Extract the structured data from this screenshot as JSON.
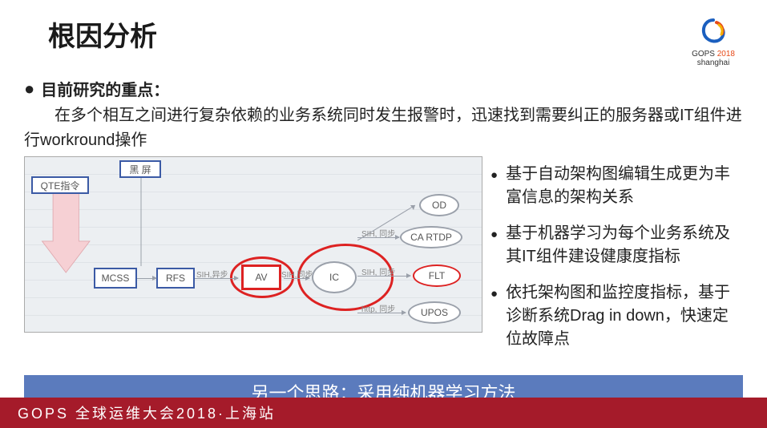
{
  "header": {
    "title": "根因分析",
    "logo_brand": "GOPS",
    "logo_year": "2018",
    "logo_city": "shanghai"
  },
  "focus": {
    "label": "目前研究的重点：",
    "body": "在多个相互之间进行复杂依赖的业务系统同时发生报警时，迅速找到需要纠正的服务器或IT组件进行workround操作"
  },
  "diagram": {
    "qte": "QTE指令",
    "blackscreen": "黑 屏",
    "mcss": "MCSS",
    "rfs": "RFS",
    "av": "AV",
    "ic": "IC",
    "od": "OD",
    "cartdp": "CA RTDP",
    "flt": "FLT",
    "upos": "UPOS",
    "labels": {
      "sih_sync1": "SIH,异步",
      "sih_sync2": "SIH,同步",
      "sih_sync3": "SIH, 同步",
      "sih_sync4": "SIH, 同步",
      "http_sync": "http, 同步"
    }
  },
  "right_points": {
    "p1": "基于自动架构图编辑生成更为丰富信息的架构关系",
    "p2": "基于机器学习为每个业务系统及其IT组件建设健康度指标",
    "p3": "依托架构图和监控度指标，基于诊断系统Drag in down，快速定位故障点"
  },
  "banner": "另一个思路：采用纯机器学习方法",
  "footer": "GOPS 全球运维大会2018·上海站"
}
